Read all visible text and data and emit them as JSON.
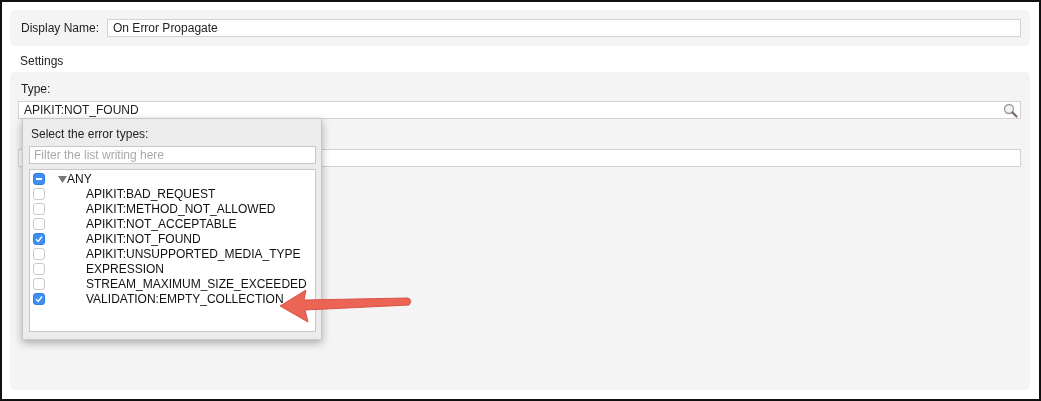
{
  "general": {
    "display_name_label": "Display Name:",
    "display_name_value": "On Error Propagate"
  },
  "settings": {
    "heading": "Settings",
    "type_label": "Type:",
    "type_value": "APIKIT:NOT_FOUND"
  },
  "error_popup": {
    "title": "Select the error types:",
    "filter_placeholder": "Filter the list writing here",
    "tree": [
      {
        "label": "ANY",
        "indeterminate": true,
        "expanded": true,
        "children": [
          {
            "label": "APIKIT:BAD_REQUEST",
            "checked": false
          },
          {
            "label": "APIKIT:METHOD_NOT_ALLOWED",
            "checked": false
          },
          {
            "label": "APIKIT:NOT_ACCEPTABLE",
            "checked": false
          },
          {
            "label": "APIKIT:NOT_FOUND",
            "checked": true
          },
          {
            "label": "APIKIT:UNSUPPORTED_MEDIA_TYPE",
            "checked": false
          },
          {
            "label": "EXPRESSION",
            "checked": false
          },
          {
            "label": "STREAM_MAXIMUM_SIZE_EXCEEDED",
            "checked": false
          },
          {
            "label": "VALIDATION:EMPTY_COLLECTION",
            "checked": true
          }
        ]
      }
    ]
  }
}
